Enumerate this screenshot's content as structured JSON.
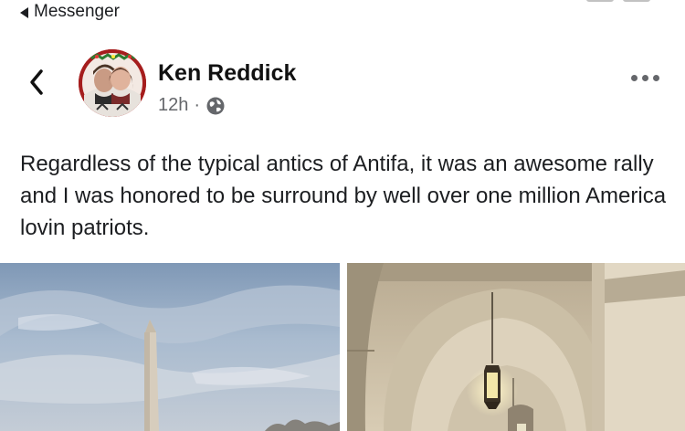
{
  "status_bar": {
    "back_app_label": "Messenger"
  },
  "post": {
    "author": "Ken Reddick",
    "time": "12h",
    "separator": "·",
    "audience_icon": "globe-icon",
    "text": "Regardless of the typical antics of Antifa, it was an awesome rally and I was honored to be surround by well over one million America lovin patriots."
  },
  "icons": {
    "back": "chevron-left-icon",
    "more": "more-horizontal-icon"
  },
  "photos": [
    {
      "name": "washington-monument-photo"
    },
    {
      "name": "capitol-corridor-photo"
    }
  ]
}
